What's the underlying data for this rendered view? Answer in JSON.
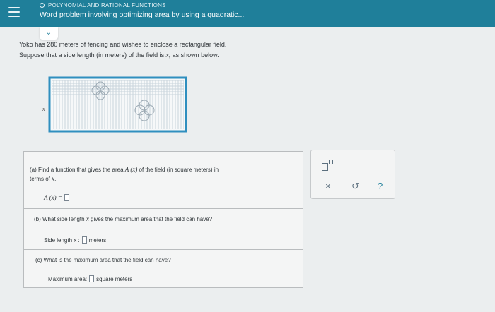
{
  "header": {
    "topic": "POLYNOMIAL AND RATIONAL FUNCTIONS",
    "title": "Word problem involving optimizing area by using a quadratic..."
  },
  "problem": {
    "line1": "Yoko has 280 meters of fencing and wishes to enclose a rectangular field.",
    "line2_pre": "Suppose that a side length (in meters) of the field is ",
    "line2_var": "x",
    "line2_post": ", as shown below.",
    "figure_label": "x"
  },
  "parts": {
    "a": {
      "question_pre": "(a) Find a function that gives the area ",
      "question_func": "A (x)",
      "question_post": " of the field (in square meters) in",
      "question_line2_pre": "terms of ",
      "question_line2_var": "x",
      "question_line2_post": ".",
      "answer_label": "A (x) ="
    },
    "b": {
      "question_pre": "(b) What side length ",
      "question_var": "x",
      "question_post": " gives the maximum area that the field can have?",
      "answer_label": "Side length x :",
      "unit": "meters"
    },
    "c": {
      "question": "(c) What is the maximum area that the field can have?",
      "answer_label": "Maximum area:",
      "unit": "square meters"
    }
  },
  "tools": {
    "superscript_icon": "superscript-icon",
    "clear_label": "×",
    "undo_label": "↺",
    "help_label": "?",
    "colors": {
      "clear": "#5b6f7e",
      "undo": "#5b6f7e",
      "help": "#1f7f9a"
    }
  },
  "colors": {
    "header_bg": "#1f7f9a",
    "page_bg": "#ebeeef"
  }
}
